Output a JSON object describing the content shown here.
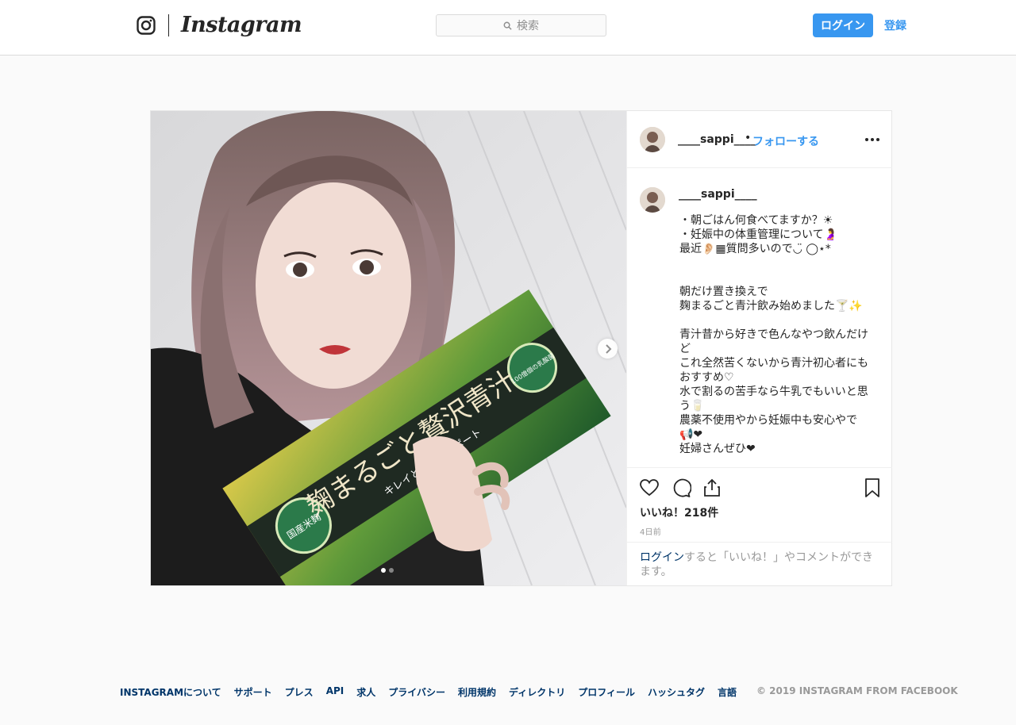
{
  "header": {
    "wordmark": "Instagram",
    "search_placeholder": "検索",
    "login_label": "ログイン",
    "signup_label": "登録",
    "icons": [
      "instagram-glyph-icon",
      "search-icon"
    ],
    "accent_color": "#3897f0"
  },
  "post": {
    "media": {
      "product_title": "麹まるごと贅沢青汁",
      "product_subtitle": "キレイと元気をサポート",
      "badge_left": "国産米麹",
      "badge_right": "100億個の乳酸菌",
      "slide_count": 2,
      "active_slide": 1
    },
    "author": {
      "username": "____sappi____",
      "separator": "•",
      "follow_label": "フォローする"
    },
    "caption_lines": [
      "・朝ごはん何食べてますか？☀",
      "・妊娠中の体重管理について🤰",
      "最近👂🏻▦質問多いので◡̈ ◯⋆*",
      "",
      "",
      "朝だけ置き換えで",
      "麹まるごと青汁飲み始めました🍸✨",
      "",
      "青汁昔から好きで色んなやつ飲んだけ",
      "ど",
      "これ全然苦くないから青汁初心者にも",
      "おすすめ♡",
      "水で割るの苦手なら牛乳でもいいと思",
      "う🥛",
      "農薬不使用やから妊娠中も安心やで",
      "📢❤",
      "妊婦さんぜひ❤"
    ],
    "likes_text": "いいね！218件",
    "timestamp": "4日前",
    "login_prompt_link": "ログイン",
    "login_prompt_text": "すると「いいね！」やコメントができます。"
  },
  "footer": {
    "links": [
      "INSTAGRAMについて",
      "サポート",
      "プレス",
      "API",
      "求人",
      "プライバシー",
      "利用規約",
      "ディレクトリ",
      "プロフィール",
      "ハッシュタグ",
      "言語"
    ],
    "copyright": "© 2019 INSTAGRAM FROM FACEBOOK"
  }
}
